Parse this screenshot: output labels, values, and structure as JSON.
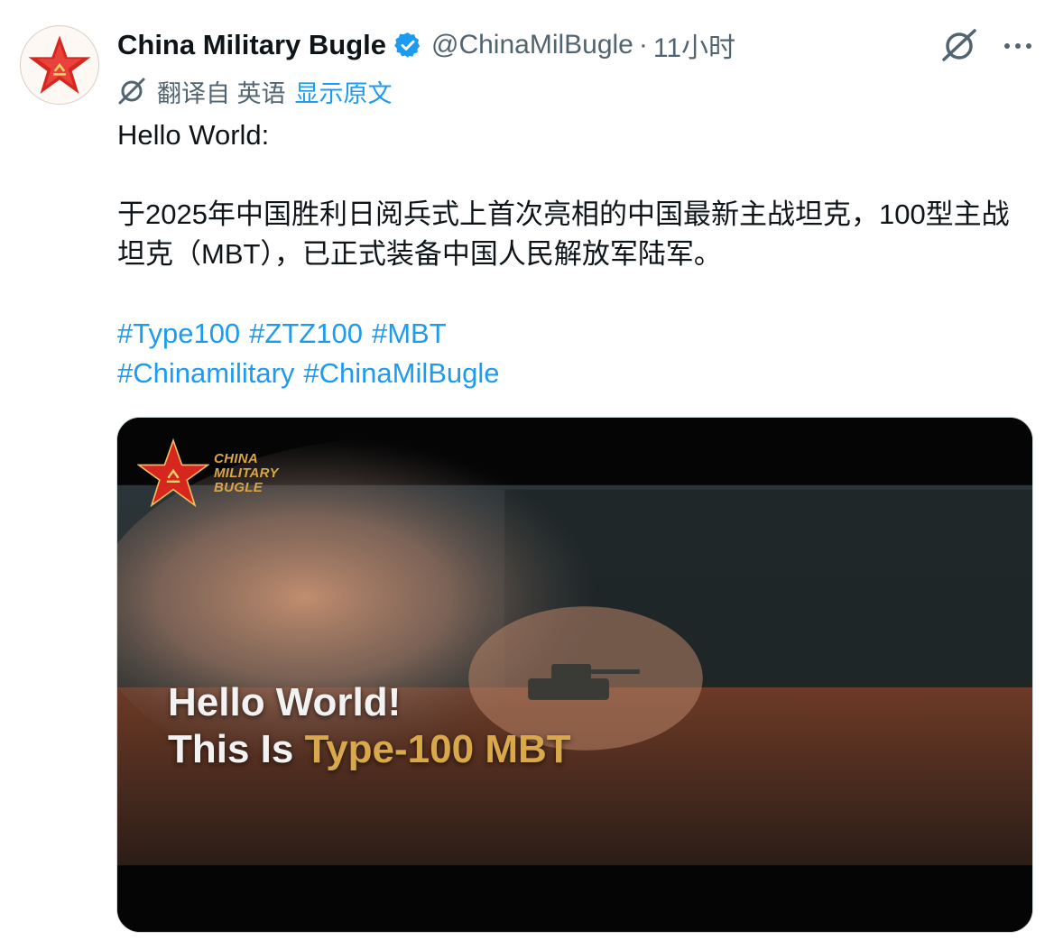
{
  "tweet": {
    "author": {
      "display_name": "China Military Bugle",
      "handle": "@ChinaMilBugle",
      "verified": true
    },
    "separator": "·",
    "time": "11小时",
    "translation": {
      "label": "翻译自 英语",
      "show_original": "显示原文"
    },
    "text": {
      "line1": "Hello World:",
      "paragraph": "于2025年中国胜利日阅兵式上首次亮相的中国最新主战坦克，100型主战坦克（MBT），已正式装备中国人民解放军陆军。"
    },
    "hashtags": [
      "#Type100",
      "#ZTZ100",
      "#MBT",
      "#Chinamilitary",
      "#ChinaMilBugle"
    ],
    "media": {
      "brand_lines": [
        "CHINA",
        "MILITARY",
        "BUGLE"
      ],
      "title_line1": "Hello World!",
      "title_line2_prefix": "This Is ",
      "title_line2_accent": "Type-100 MBT"
    }
  },
  "icons": {
    "verified": "verified-badge-icon",
    "grok": "grok-icon",
    "more": "more-icon",
    "translate": "translate-icon"
  },
  "colors": {
    "accent": "#1d9bf0",
    "text": "#0f1419",
    "muted": "#536471",
    "star_red": "#d7261e",
    "caption_gold": "#d8a84a"
  }
}
